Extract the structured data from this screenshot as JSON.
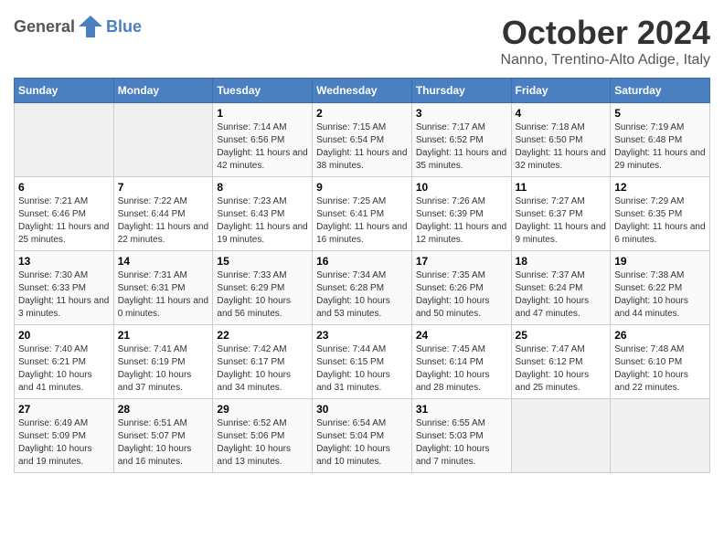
{
  "header": {
    "logo": {
      "text_general": "General",
      "text_blue": "Blue"
    },
    "title": "October 2024",
    "location": "Nanno, Trentino-Alto Adige, Italy"
  },
  "calendar": {
    "days_of_week": [
      "Sunday",
      "Monday",
      "Tuesday",
      "Wednesday",
      "Thursday",
      "Friday",
      "Saturday"
    ],
    "weeks": [
      [
        {
          "day": "",
          "info": ""
        },
        {
          "day": "",
          "info": ""
        },
        {
          "day": "1",
          "info": "Sunrise: 7:14 AM\nSunset: 6:56 PM\nDaylight: 11 hours and 42 minutes."
        },
        {
          "day": "2",
          "info": "Sunrise: 7:15 AM\nSunset: 6:54 PM\nDaylight: 11 hours and 38 minutes."
        },
        {
          "day": "3",
          "info": "Sunrise: 7:17 AM\nSunset: 6:52 PM\nDaylight: 11 hours and 35 minutes."
        },
        {
          "day": "4",
          "info": "Sunrise: 7:18 AM\nSunset: 6:50 PM\nDaylight: 11 hours and 32 minutes."
        },
        {
          "day": "5",
          "info": "Sunrise: 7:19 AM\nSunset: 6:48 PM\nDaylight: 11 hours and 29 minutes."
        }
      ],
      [
        {
          "day": "6",
          "info": "Sunrise: 7:21 AM\nSunset: 6:46 PM\nDaylight: 11 hours and 25 minutes."
        },
        {
          "day": "7",
          "info": "Sunrise: 7:22 AM\nSunset: 6:44 PM\nDaylight: 11 hours and 22 minutes."
        },
        {
          "day": "8",
          "info": "Sunrise: 7:23 AM\nSunset: 6:43 PM\nDaylight: 11 hours and 19 minutes."
        },
        {
          "day": "9",
          "info": "Sunrise: 7:25 AM\nSunset: 6:41 PM\nDaylight: 11 hours and 16 minutes."
        },
        {
          "day": "10",
          "info": "Sunrise: 7:26 AM\nSunset: 6:39 PM\nDaylight: 11 hours and 12 minutes."
        },
        {
          "day": "11",
          "info": "Sunrise: 7:27 AM\nSunset: 6:37 PM\nDaylight: 11 hours and 9 minutes."
        },
        {
          "day": "12",
          "info": "Sunrise: 7:29 AM\nSunset: 6:35 PM\nDaylight: 11 hours and 6 minutes."
        }
      ],
      [
        {
          "day": "13",
          "info": "Sunrise: 7:30 AM\nSunset: 6:33 PM\nDaylight: 11 hours and 3 minutes."
        },
        {
          "day": "14",
          "info": "Sunrise: 7:31 AM\nSunset: 6:31 PM\nDaylight: 11 hours and 0 minutes."
        },
        {
          "day": "15",
          "info": "Sunrise: 7:33 AM\nSunset: 6:29 PM\nDaylight: 10 hours and 56 minutes."
        },
        {
          "day": "16",
          "info": "Sunrise: 7:34 AM\nSunset: 6:28 PM\nDaylight: 10 hours and 53 minutes."
        },
        {
          "day": "17",
          "info": "Sunrise: 7:35 AM\nSunset: 6:26 PM\nDaylight: 10 hours and 50 minutes."
        },
        {
          "day": "18",
          "info": "Sunrise: 7:37 AM\nSunset: 6:24 PM\nDaylight: 10 hours and 47 minutes."
        },
        {
          "day": "19",
          "info": "Sunrise: 7:38 AM\nSunset: 6:22 PM\nDaylight: 10 hours and 44 minutes."
        }
      ],
      [
        {
          "day": "20",
          "info": "Sunrise: 7:40 AM\nSunset: 6:21 PM\nDaylight: 10 hours and 41 minutes."
        },
        {
          "day": "21",
          "info": "Sunrise: 7:41 AM\nSunset: 6:19 PM\nDaylight: 10 hours and 37 minutes."
        },
        {
          "day": "22",
          "info": "Sunrise: 7:42 AM\nSunset: 6:17 PM\nDaylight: 10 hours and 34 minutes."
        },
        {
          "day": "23",
          "info": "Sunrise: 7:44 AM\nSunset: 6:15 PM\nDaylight: 10 hours and 31 minutes."
        },
        {
          "day": "24",
          "info": "Sunrise: 7:45 AM\nSunset: 6:14 PM\nDaylight: 10 hours and 28 minutes."
        },
        {
          "day": "25",
          "info": "Sunrise: 7:47 AM\nSunset: 6:12 PM\nDaylight: 10 hours and 25 minutes."
        },
        {
          "day": "26",
          "info": "Sunrise: 7:48 AM\nSunset: 6:10 PM\nDaylight: 10 hours and 22 minutes."
        }
      ],
      [
        {
          "day": "27",
          "info": "Sunrise: 6:49 AM\nSunset: 5:09 PM\nDaylight: 10 hours and 19 minutes."
        },
        {
          "day": "28",
          "info": "Sunrise: 6:51 AM\nSunset: 5:07 PM\nDaylight: 10 hours and 16 minutes."
        },
        {
          "day": "29",
          "info": "Sunrise: 6:52 AM\nSunset: 5:06 PM\nDaylight: 10 hours and 13 minutes."
        },
        {
          "day": "30",
          "info": "Sunrise: 6:54 AM\nSunset: 5:04 PM\nDaylight: 10 hours and 10 minutes."
        },
        {
          "day": "31",
          "info": "Sunrise: 6:55 AM\nSunset: 5:03 PM\nDaylight: 10 hours and 7 minutes."
        },
        {
          "day": "",
          "info": ""
        },
        {
          "day": "",
          "info": ""
        }
      ]
    ]
  }
}
